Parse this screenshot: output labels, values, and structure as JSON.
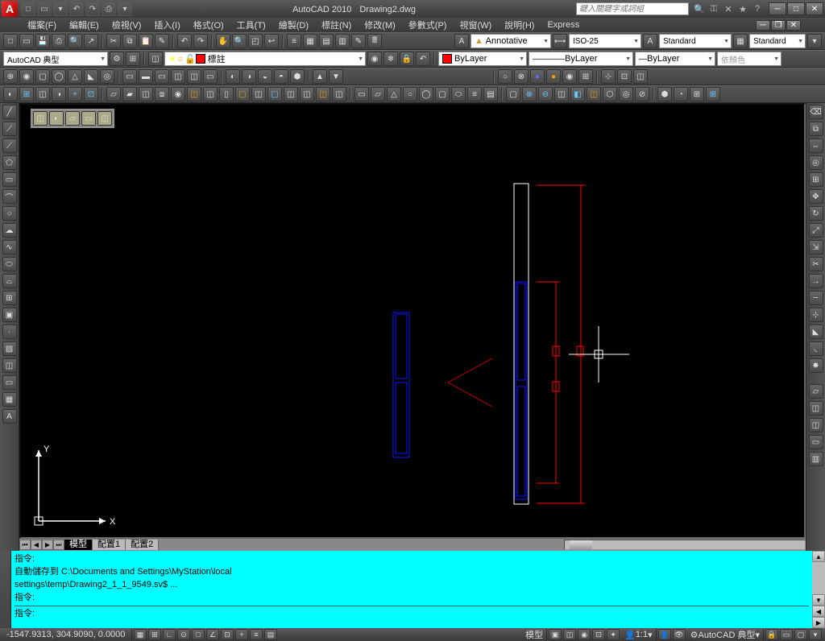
{
  "title": {
    "app": "AutoCAD 2010",
    "doc": "Drawing2.dwg"
  },
  "search_placeholder": "鍵入關鍵字或詞組",
  "menus": [
    "檔案(F)",
    "編輯(E)",
    "檢視(V)",
    "插入(I)",
    "格式(O)",
    "工具(T)",
    "繪製(D)",
    "標註(N)",
    "修改(M)",
    "參數式(P)",
    "視窗(W)",
    "說明(H)",
    "Express"
  ],
  "props": {
    "annotative": "Annotative",
    "dimstyle": "ISO-25",
    "textstyle": "Standard",
    "tablestyle": "Standard",
    "workspace": "AutoCAD 典型",
    "layer": "標註",
    "bylayer_color": "ByLayer",
    "bylayer_line": "ByLayer",
    "bylayer_weight": "ByLayer",
    "bycolor": "依顏色"
  },
  "tabs": {
    "model": "模型",
    "layout1": "配置1",
    "layout2": "配置2"
  },
  "ucs": {
    "x": "X",
    "y": "Y"
  },
  "cmd": {
    "l1": "指令:",
    "l2": "自動儲存到 C:\\Documents and Settings\\MyStation\\local",
    "l3": "settings\\temp\\Drawing2_1_1_9549.sv$ ...",
    "l4": "指令:",
    "l5": "指令:"
  },
  "status": {
    "coords": "-1547.9313, 304.9090, 0.0000",
    "model": "模型",
    "scale": "1:1",
    "ws": "AutoCAD 典型"
  }
}
